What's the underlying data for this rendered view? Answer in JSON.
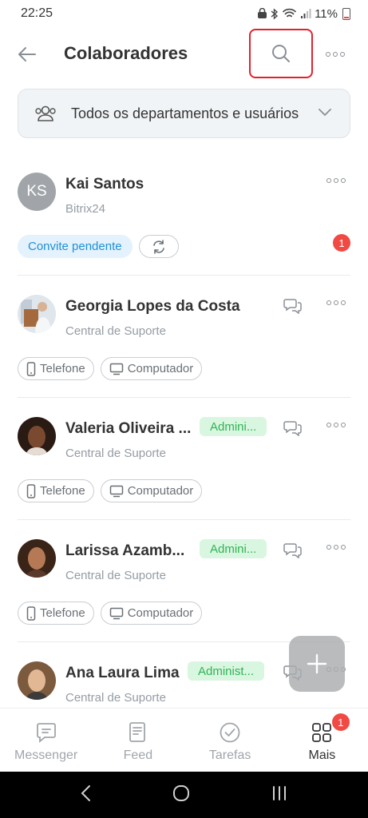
{
  "status_bar": {
    "time": "22:25",
    "battery": "11%"
  },
  "header": {
    "title": "Colaboradores"
  },
  "filter": {
    "label": "Todos os departamentos e usuários"
  },
  "users": [
    {
      "name": "Kai Santos",
      "subtitle": "Bitrix24",
      "initials": "KS",
      "invite_label": "Convite pendente",
      "notification_count": "1"
    },
    {
      "name": "Georgia Lopes da Costa",
      "subtitle": "Central de Suporte",
      "chips": [
        "Telefone",
        "Computador"
      ]
    },
    {
      "name": "Valeria Oliveira ...",
      "subtitle": "Central de Suporte",
      "badge": "Admini...",
      "chips": [
        "Telefone",
        "Computador"
      ]
    },
    {
      "name": "Larissa Azamb...",
      "subtitle": "Central de Suporte",
      "badge": "Admini...",
      "chips": [
        "Telefone",
        "Computador"
      ]
    },
    {
      "name": "Ana Laura Lima",
      "subtitle": "Central de Suporte",
      "badge": "Administ..."
    }
  ],
  "tabs": [
    {
      "label": "Messenger",
      "icon": "messenger-icon"
    },
    {
      "label": "Feed",
      "icon": "feed-icon"
    },
    {
      "label": "Tarefas",
      "icon": "tasks-icon"
    },
    {
      "label": "Mais",
      "icon": "grid-icon",
      "badge": "1",
      "active": true
    }
  ],
  "colors": {
    "accent_red": "#e2222b",
    "admin_green": "#2fb454",
    "invite_blue": "#2090d9",
    "badge_red": "#f14a44"
  }
}
